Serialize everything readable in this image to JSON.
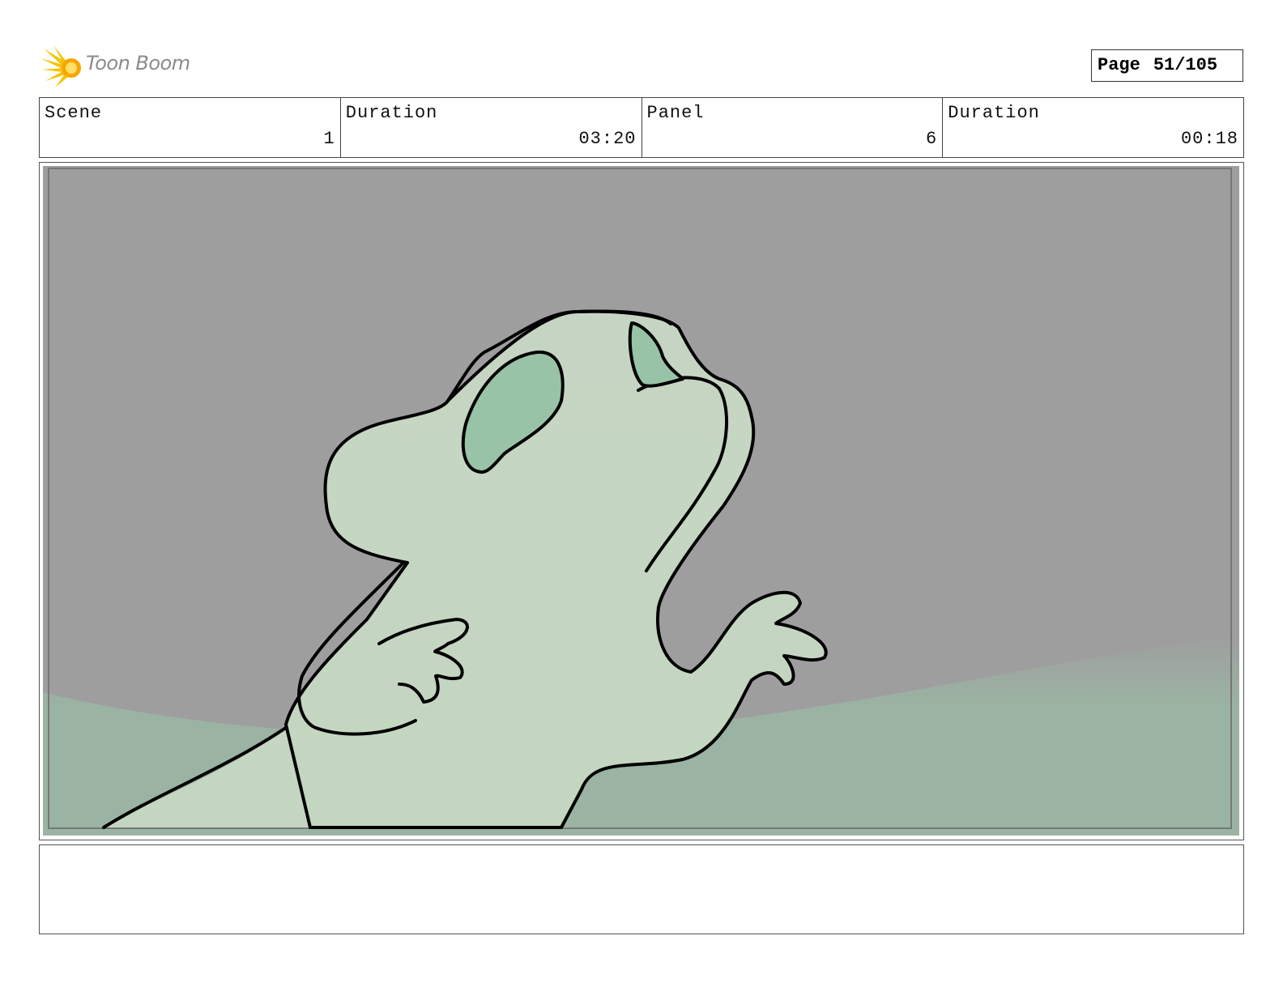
{
  "brand": {
    "name": "Toon Boom",
    "logo_icon": "starburst-icon",
    "logo_color": "#f5c400"
  },
  "page": {
    "label": "Page",
    "number": "51/105"
  },
  "info": {
    "scene_label": "Scene",
    "scene_value": "1",
    "scene_duration_label": "Duration",
    "scene_duration_value": "03:20",
    "panel_label": "Panel",
    "panel_value": "6",
    "panel_duration_label": "Duration",
    "panel_duration_value": "00:18"
  },
  "panel": {
    "background_color": "#9e9e9e",
    "ground_color": "#9bb3a3",
    "character_color": "#c6d5c3",
    "eye_color": "#99c3a6",
    "outline_color": "#000000"
  },
  "caption": {
    "text": ""
  }
}
